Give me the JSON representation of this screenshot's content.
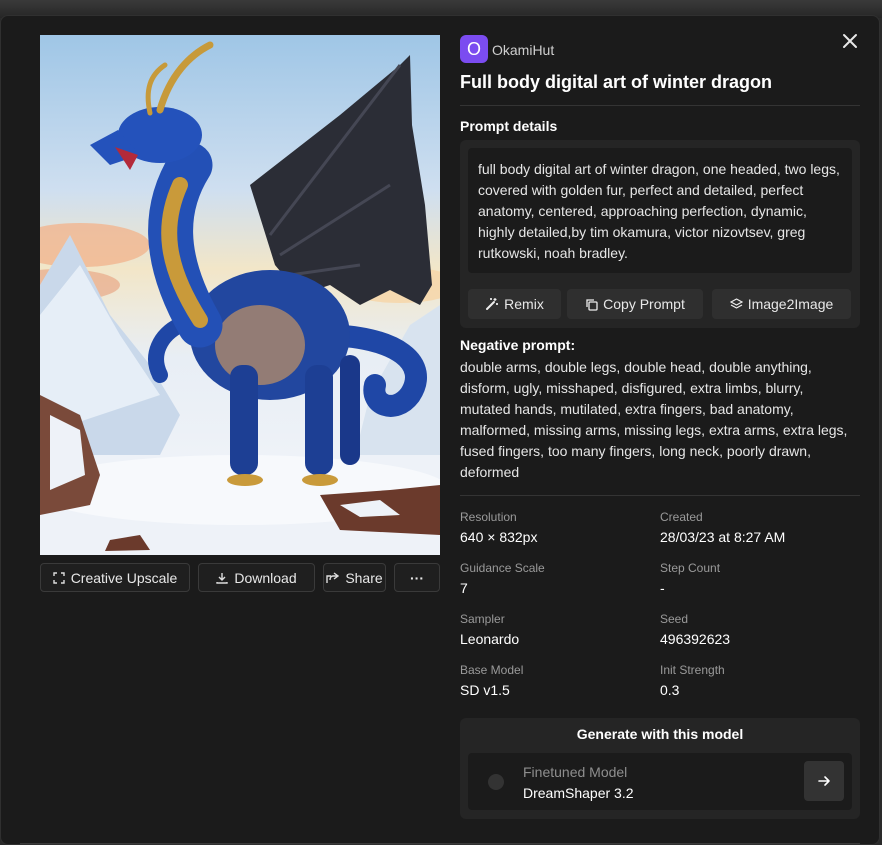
{
  "user": {
    "avatar_letter": "O",
    "name": "OkamiHut"
  },
  "title": "Full body digital art of winter dragon",
  "image_actions": {
    "upscale": "Creative Upscale",
    "download": "Download",
    "share": "Share",
    "more": "···"
  },
  "prompt": {
    "label": "Prompt details",
    "text": "full body digital art of winter dragon, one headed, two legs, covered with golden fur, perfect and detailed, perfect anatomy, centered, approaching perfection, dynamic, highly detailed,by tim okamura, victor nizovtsev, greg rutkowski, noah bradley.",
    "buttons": {
      "remix": "Remix",
      "copy": "Copy Prompt",
      "img2img": "Image2Image"
    }
  },
  "negative": {
    "label": "Negative prompt:",
    "text": "double arms, double legs, double head, double anything, disform, ugly, misshaped, disfigured, extra limbs, blurry, mutated hands, mutilated, extra fingers, bad anatomy, malformed, missing arms, missing legs, extra arms, extra legs, fused fingers, too many fingers, long neck, poorly drawn, deformed"
  },
  "meta": {
    "resolution": {
      "label": "Resolution",
      "value": "640 × 832px"
    },
    "created": {
      "label": "Created",
      "value": "28/03/23 at 8:27 AM"
    },
    "guidance": {
      "label": "Guidance Scale",
      "value": "7"
    },
    "steps": {
      "label": "Step Count",
      "value": "-"
    },
    "sampler": {
      "label": "Sampler",
      "value": "Leonardo"
    },
    "seed": {
      "label": "Seed",
      "value": "496392623"
    },
    "base_model": {
      "label": "Base Model",
      "value": "SD v1.5"
    },
    "init_strength": {
      "label": "Init Strength",
      "value": "0.3"
    }
  },
  "generate": {
    "title": "Generate with this model",
    "model_label": "Finetuned Model",
    "model_name": "DreamShaper 3.2"
  },
  "colors": {
    "accent": "#7b4cf0",
    "panel": "#1b1b1b",
    "card": "#252525"
  }
}
